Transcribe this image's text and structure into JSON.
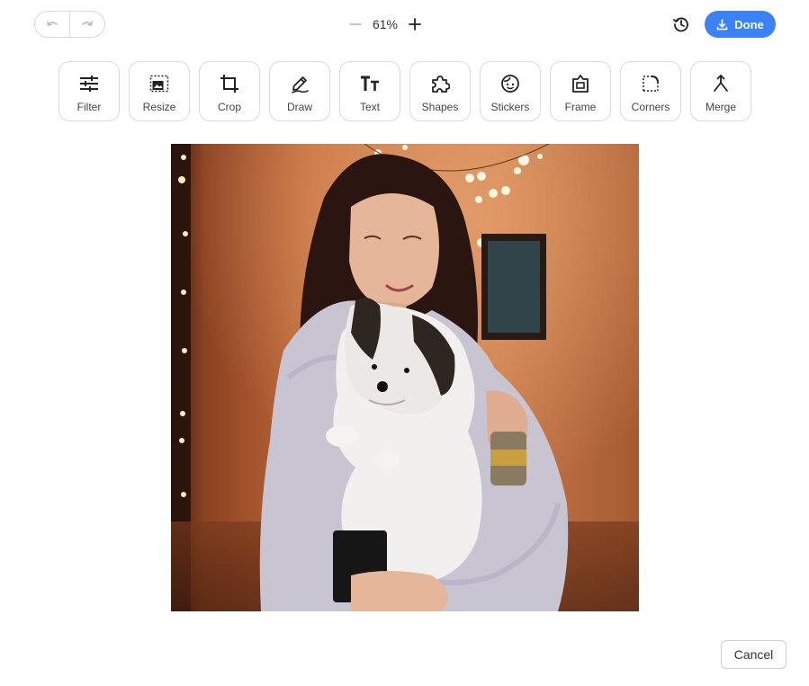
{
  "header": {
    "undo_icon": "undo-icon",
    "redo_icon": "redo-icon",
    "zoom_out_icon": "minus-icon",
    "zoom_value": "61%",
    "zoom_in_icon": "plus-icon",
    "history_icon": "history-icon",
    "done_label": "Done",
    "done_icon": "download-icon",
    "accent_color": "#3b82f6"
  },
  "tools": [
    {
      "id": "filter",
      "label": "Filter",
      "icon": "sliders-icon"
    },
    {
      "id": "resize",
      "label": "Resize",
      "icon": "resize-icon"
    },
    {
      "id": "crop",
      "label": "Crop",
      "icon": "crop-icon"
    },
    {
      "id": "draw",
      "label": "Draw",
      "icon": "pen-icon"
    },
    {
      "id": "text",
      "label": "Text",
      "icon": "text-icon"
    },
    {
      "id": "shapes",
      "label": "Shapes",
      "icon": "puzzle-icon"
    },
    {
      "id": "stickers",
      "label": "Stickers",
      "icon": "sticker-icon"
    },
    {
      "id": "frame",
      "label": "Frame",
      "icon": "frame-icon"
    },
    {
      "id": "corners",
      "label": "Corners",
      "icon": "corners-icon"
    },
    {
      "id": "merge",
      "label": "Merge",
      "icon": "merge-icon"
    }
  ],
  "canvas": {
    "image_description": "photo-of-woman-hugging-dog"
  },
  "footer": {
    "cancel_label": "Cancel"
  }
}
